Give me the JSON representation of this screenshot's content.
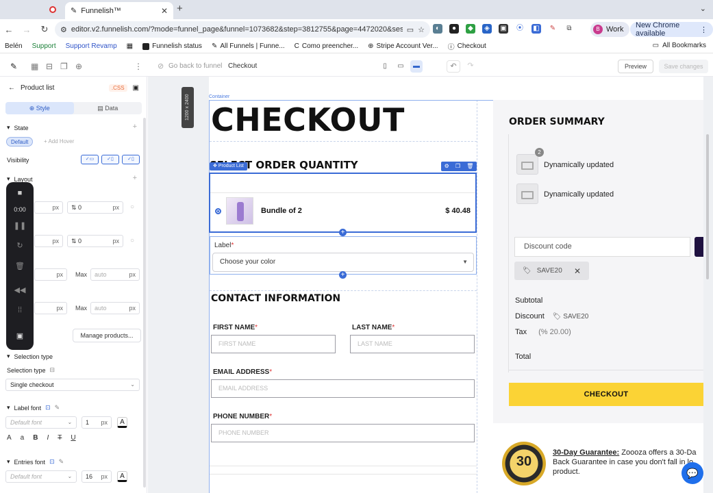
{
  "browser": {
    "tab_title": "Funnelish™",
    "url": "editor.v2.funnelish.com/?mode=funnel_page&funnel=1073682&step=3812755&page=4472020&sessi...",
    "profile_label": "Work",
    "profile_initial": "B",
    "update_label": "New Chrome available",
    "bookmarks": [
      "Belén",
      "Support",
      "Support Revamp",
      "Funnelish status",
      "All Funnels | Funne...",
      "Como preencher...",
      "Stripe Account Ver...",
      "Checkout"
    ],
    "all_bookmarks": "All Bookmarks"
  },
  "editor_top": {
    "go_back": "Go back to funnel",
    "page_name": "Checkout",
    "preview": "Preview",
    "save": "Save changes"
  },
  "left_panel": {
    "title": "Product list",
    "css_tag": ".CSS",
    "tab_style": "Style",
    "tab_data": "Data",
    "state_label": "State",
    "state_default": "Default",
    "add_hover": "+ Add Hover",
    "visibility_label": "Visibility",
    "layout_label": "Layout",
    "field_value": "0",
    "unit_px": "px",
    "max_label": "Max",
    "auto_placeholder": "auto",
    "manage_products": "Manage products...",
    "selection_type_section": "Selection type",
    "selection_type_label": "Selection type",
    "selection_type_value": "Single checkout",
    "label_font_section": "Label font",
    "label_font_value": "Default font",
    "label_font_size": "1",
    "entries_font_section": "Entries font",
    "entries_font_value": "Default font",
    "entries_font_size": "16",
    "fmt_upper": "A",
    "fmt_lower": "a",
    "fmt_bold": "B",
    "fmt_italic": "I",
    "fmt_strike": "T",
    "fmt_underline": "U"
  },
  "recorder": {
    "time": "0:00"
  },
  "canvas": {
    "size_badge": "1200 x 2400",
    "container_tag": "Container",
    "heading_checkout": "CHECKOUT",
    "heading_select": "SELECT ORDER QUANTITY",
    "product_list_tag": "Product List",
    "product_name": "Bundle of 2",
    "product_price": "$ 40.48",
    "variant_label": "Label",
    "variant_placeholder": "Choose your color",
    "heading_contact": "CONTACT INFORMATION",
    "first_name_label": "FIRST NAME",
    "first_name_placeholder": "FIRST NAME",
    "last_name_label": "LAST NAME",
    "last_name_placeholder": "LAST NAME",
    "email_label": "EMAIL ADDRESS",
    "email_placeholder": "EMAIL ADDRESS",
    "phone_label": "PHONE NUMBER",
    "phone_placeholder": "PHONE NUMBER",
    "required_mark": "*"
  },
  "summary": {
    "heading": "ORDER SUMMARY",
    "qty_badge": "2",
    "item1": "Dynamically updated",
    "item2": "Dynamically updated",
    "discount_placeholder": "Discount code",
    "coupon": "SAVE20",
    "subtotal_label": "Subtotal",
    "discount_label": "Discount",
    "discount_code": "SAVE20",
    "tax_label": "Tax",
    "tax_value": "(% 20.00)",
    "total_label": "Total",
    "checkout_button": "CHECKOUT"
  },
  "guarantee": {
    "seal_text": "30",
    "title": "30-Day Guarantee:",
    "line1": " Zoooza offers a 30-Da",
    "line2": "Back Guarantee in case you don't fall in lo",
    "line3": "product."
  }
}
